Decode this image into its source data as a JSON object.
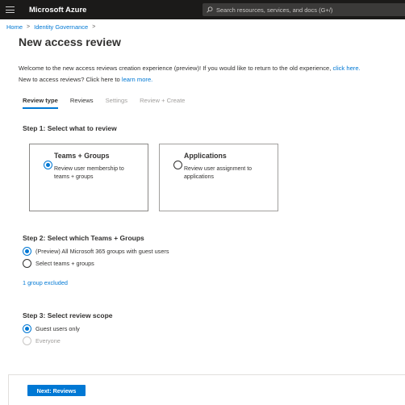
{
  "topbar": {
    "brand": "Microsoft Azure",
    "search_placeholder": "Search resources, services, and docs (G+/)",
    "colors": {
      "bar": "#1b1a19",
      "search_bg": "#3b3a39"
    }
  },
  "breadcrumb": {
    "items": [
      "Home",
      "Identity Governance"
    ]
  },
  "page": {
    "title": "New access review"
  },
  "intro": {
    "line1_text": "Welcome to the new access reviews creation experience (preview)! If you would like to return to the old experience,",
    "line1_link": "click here.",
    "line2_text": "New to access reviews? Click here to",
    "line2_link": "learn more."
  },
  "tabs": [
    {
      "label": "Review type",
      "state": "active"
    },
    {
      "label": "Reviews",
      "state": "enabled"
    },
    {
      "label": "Settings",
      "state": "disabled"
    },
    {
      "label": "Review + Create",
      "state": "disabled"
    }
  ],
  "step1": {
    "title": "Step 1: Select what to review",
    "cards": [
      {
        "title": "Teams + Groups",
        "description": "Review user membership to teams + groups",
        "selected": true
      },
      {
        "title": "Applications",
        "description": "Review user assignment to applications",
        "selected": false
      }
    ]
  },
  "step2": {
    "title": "Step 2: Select which Teams + Groups",
    "options": [
      {
        "label": "(Preview) All Microsoft 365 groups with guest users",
        "selected": true
      },
      {
        "label": "Select teams + groups",
        "selected": false
      }
    ],
    "excluded_link": "1 group excluded"
  },
  "step3": {
    "title": "Step 3: Select review scope",
    "options": [
      {
        "label": "Guest users only",
        "selected": true,
        "disabled": false
      },
      {
        "label": "Everyone",
        "selected": false,
        "disabled": true
      }
    ]
  },
  "footer": {
    "next_label": "Next: Reviews"
  },
  "colors": {
    "accent": "#0078d4",
    "text": "#323130",
    "disabled": "#a19f9d"
  }
}
